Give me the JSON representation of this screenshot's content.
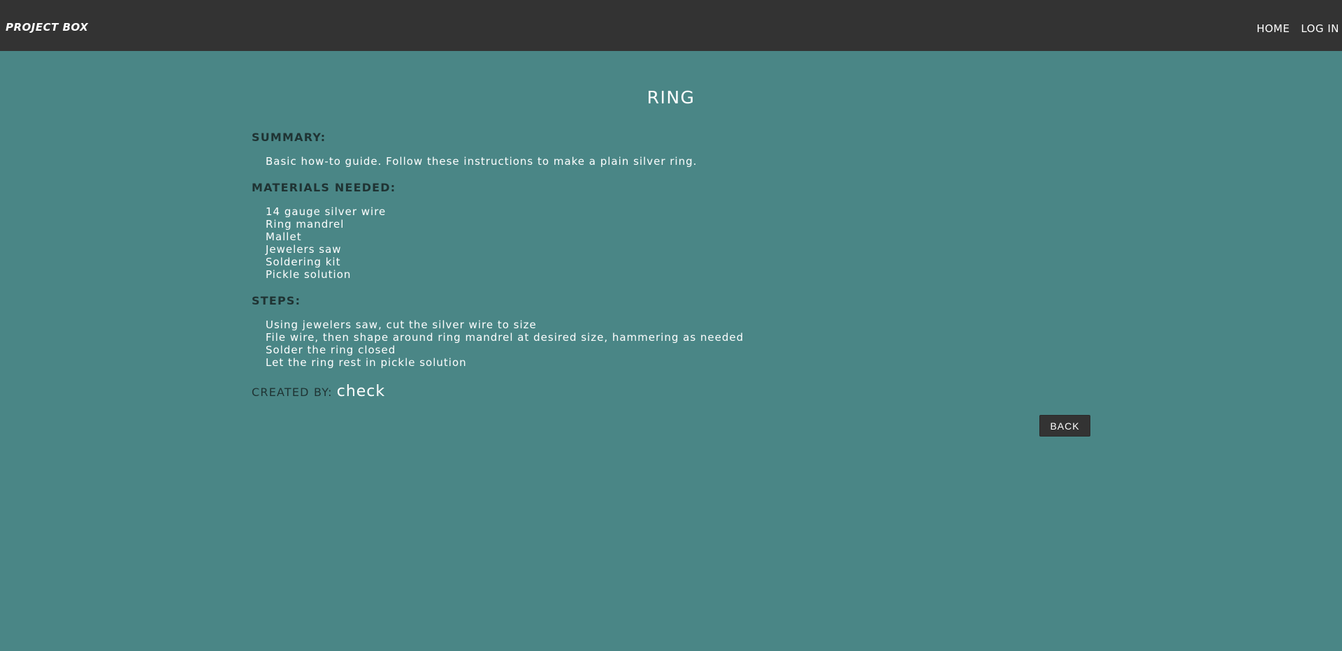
{
  "nav": {
    "brand": "PROJECT BOX",
    "links": [
      "HOME",
      "LOG IN"
    ]
  },
  "project": {
    "title": "RING",
    "summary_heading": "SUMMARY:",
    "summary": "Basic how-to guide. Follow these instructions to make a plain silver ring.",
    "materials_heading": "MATERIALS NEEDED:",
    "materials": [
      "14 gauge silver wire",
      "Ring mandrel",
      "Mallet",
      "Jewelers saw",
      "Soldering kit",
      "Pickle solution"
    ],
    "steps_heading": "STEPS:",
    "steps": [
      "Using jewelers saw, cut the silver wire to size",
      "File wire, then shape around ring mandrel at desired size, hammering as needed",
      "Solder the ring closed",
      "Let the ring rest in pickle solution"
    ],
    "created_by_label": "CREATED BY:",
    "created_by": "check"
  },
  "actions": {
    "back_label": "BACK"
  },
  "colors": {
    "background": "#4a8686",
    "navbar": "#333333",
    "heading_text": "#1f3333",
    "body_text": "#ffffff"
  }
}
